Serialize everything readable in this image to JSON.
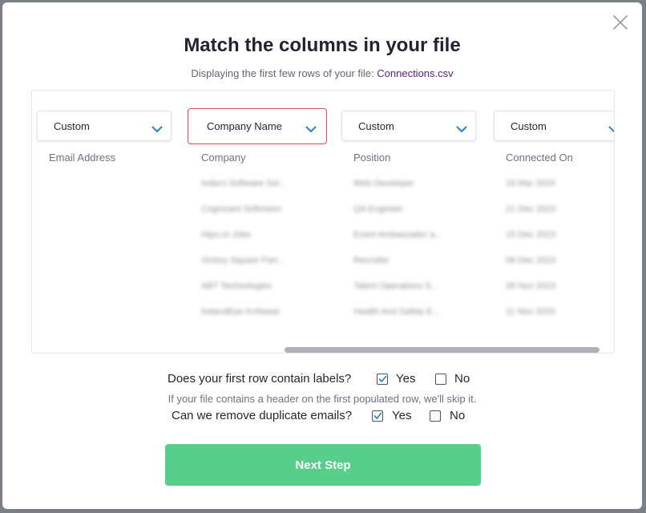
{
  "title": "Match the columns in your file",
  "subtitle": {
    "prefix": "Displaying the first few rows of your file:",
    "filename": "Connections.csv"
  },
  "columns": [
    {
      "dropdown": "Custom",
      "header": "Email Address",
      "highlighted": false,
      "values": []
    },
    {
      "dropdown": "Company Name",
      "header": "Company",
      "highlighted": true,
      "values": [
        "India's Software Sol...",
        "Cognizant Softvision",
        "Hipo.ro Jobs",
        "Victory Square Part...",
        "ABT Technologies",
        "IrelandEye Knitwear"
      ]
    },
    {
      "dropdown": "Custom",
      "header": "Position",
      "highlighted": false,
      "values": [
        "Web Developer",
        "QA Engineer",
        "Event Ambassador a...",
        "Recruiter",
        "Talent Operations S...",
        "Health And Safety E..."
      ]
    },
    {
      "dropdown": "Custom",
      "header": "Connected On",
      "highlighted": false,
      "values": [
        "18 Mar 2024",
        "21 Dec 2023",
        "15 Dec 2023",
        "08 Dec 2023",
        "28 Nov 2023",
        "11 Nov 2023"
      ]
    }
  ],
  "labels_question": {
    "text": "Does your first row contain labels?",
    "yes": "Yes",
    "no": "No",
    "yes_checked": true,
    "no_checked": false
  },
  "hint": "If your file contains a header on the first populated row, we'll skip it.",
  "duplicates_question": {
    "text": "Can we remove duplicate emails?",
    "yes": "Yes",
    "no": "No",
    "yes_checked": true,
    "no_checked": false
  },
  "next_button": "Next Step",
  "colors": {
    "accent_green": "#57cf8a",
    "link_purple": "#5a1f7a",
    "chevron_blue": "#2a83c4",
    "highlight_red": "#d9534f"
  },
  "icons": {
    "close": "close-icon",
    "dropdown": "chevron-down-icon",
    "check": "checkmark-icon"
  }
}
